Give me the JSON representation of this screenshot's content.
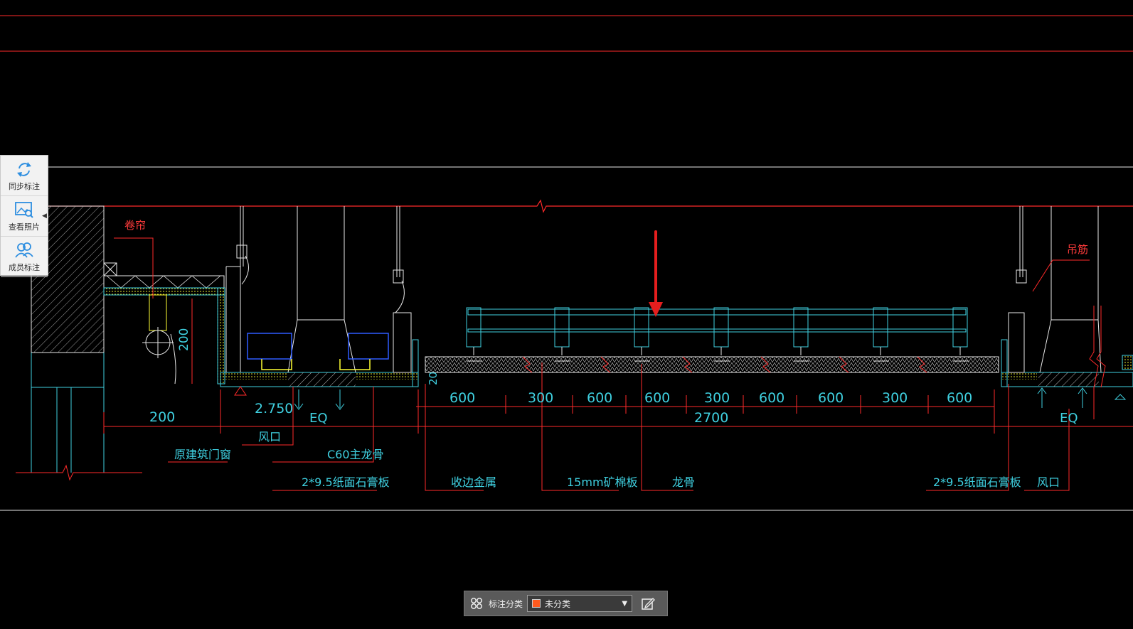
{
  "colors": {
    "red": "#ff2a2a",
    "cyan": "#3fd0e0",
    "white": "#ffffff",
    "yellow": "#ffff33",
    "blue": "#2f5cff",
    "arrow": "#e51e1e",
    "category_swatch": "#ff5a1e"
  },
  "side_panel": {
    "tools": [
      {
        "label": "同步标注",
        "icon": "sync-icon"
      },
      {
        "label": "查看照片",
        "icon": "photo-search-icon"
      },
      {
        "label": "成员标注",
        "icon": "members-icon"
      }
    ]
  },
  "drawing": {
    "labels": {
      "curtain": "卷帘",
      "hanger": "吊筋",
      "dim_200_v": "200",
      "dim_20": "20",
      "dim_200": "200",
      "elev": "2.750",
      "eq_left": "EQ",
      "eq_right": "EQ",
      "dim_2700": "2700",
      "air_left": "风口",
      "air_right": "风口",
      "window": "原建筑门窗",
      "c60": "C60主龙骨",
      "gypsum_left": "2*9.5纸面石膏板",
      "gypsum_right": "2*9.5纸面石膏板",
      "trim": "收边金属",
      "mineral": "15mm矿棉板",
      "keel": "龙骨"
    },
    "segments": [
      "600",
      "300",
      "600",
      "600",
      "300",
      "600",
      "600",
      "300",
      "600"
    ]
  },
  "toolbar": {
    "category_label": "标注分类",
    "category_value": "未分类"
  }
}
